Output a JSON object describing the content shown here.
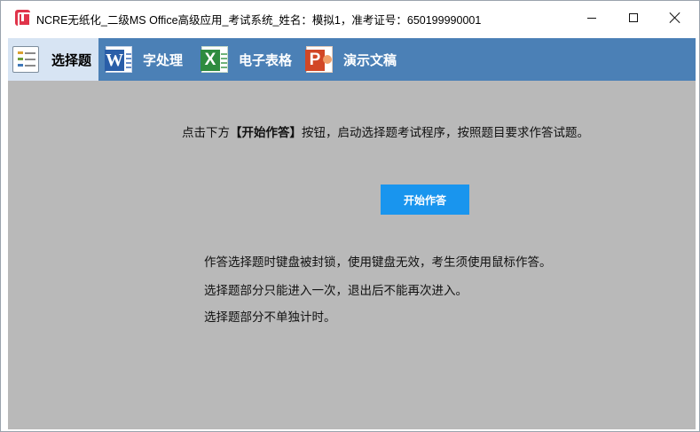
{
  "window": {
    "title": "NCRE无纸化_二级MS Office高级应用_考试系统_姓名：模拟1，准考证号：650199990001"
  },
  "tabs": [
    {
      "label": "选择题",
      "icon": "choice-question-icon",
      "active": true
    },
    {
      "label": "字处理",
      "icon": "word-icon",
      "active": false
    },
    {
      "label": "电子表格",
      "icon": "excel-icon",
      "active": false
    },
    {
      "label": "演示文稿",
      "icon": "powerpoint-icon",
      "active": false
    }
  ],
  "icons": {
    "word_letter": "W",
    "excel_letter": "X",
    "ppt_letter": "P"
  },
  "instruction": {
    "prefix": "点击下方",
    "highlight": "【开始作答】",
    "suffix": "按钮，启动选择题考试程序，按照题目要求作答试题。"
  },
  "start_button": {
    "label": "开始作答"
  },
  "notes": [
    "作答选择题时键盘被封锁，使用键盘无效，考生须使用鼠标作答。",
    "选择题部分只能进入一次，退出后不能再次进入。",
    "选择题部分不单独计时。"
  ],
  "colors": {
    "tab_bar": "#4b80b6",
    "active_tab": "#d7e4f3",
    "content_bg": "#b9b9b9",
    "start_button": "#1995ee"
  }
}
